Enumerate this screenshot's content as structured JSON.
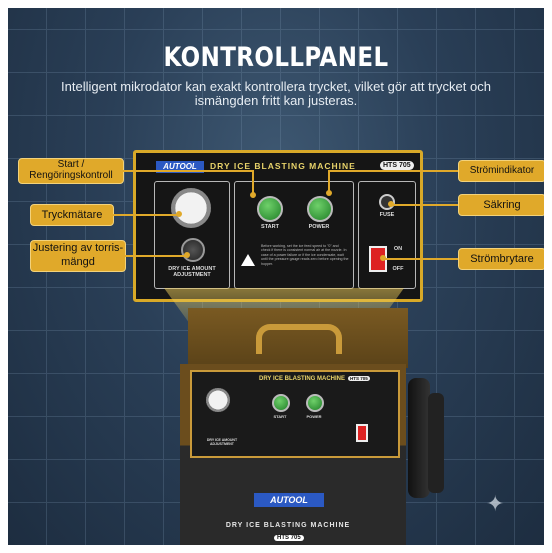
{
  "header": {
    "title": "KONTROLLPANEL",
    "subtitle": "Intelligent mikrodator kan exakt kontrollera trycket, vilket gör att trycket och ismängden fritt kan justeras."
  },
  "panel": {
    "brand": "AUTOOL",
    "title": "DRY ICE BLASTING MACHINE",
    "model": "HTS 705",
    "start_label": "START",
    "power_label": "POWER",
    "fuse_label": "FUSE",
    "on_label": "ON",
    "off_label": "OFF",
    "adjust_label": "DRY ICE AMOUNT ADJUSTMENT",
    "warning_text": "Before working, set the ice feed speed to \"0\" and check if there is consistent normal air at the nozzle. In case of a power failure or if the ice condensate, wait until the pressure gauge reads zero before opening the hopper."
  },
  "callouts": {
    "start": "Start / Rengöringskontroll",
    "gauge": "Tryckmätare",
    "adjust": "Justering av torris-mängd",
    "power": "Strömindikator",
    "fuse": "Säkring",
    "switch": "Strömbrytare"
  },
  "machine": {
    "brand": "AUTOOL",
    "title": "DRY ICE BLASTING MACHINE",
    "model": "HTS 705",
    "mini_title": "DRY ICE BLASTING MACHINE",
    "mini_model": "HTS 705",
    "mini_start": "START",
    "mini_power": "POWER",
    "mini_adjust": "DRY ICE AMOUNT ADJUSTMENT"
  },
  "colors": {
    "accent": "#e0a92a",
    "background": "#2a3f57",
    "brand": "#2b59c3"
  }
}
